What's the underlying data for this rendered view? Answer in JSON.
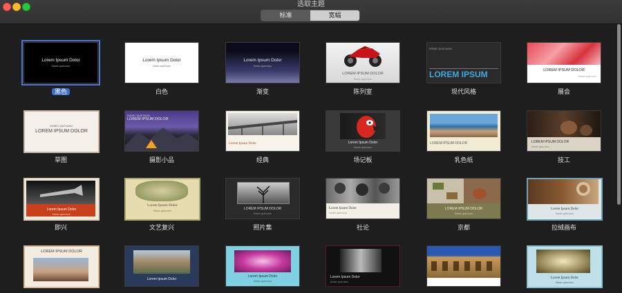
{
  "window": {
    "title": "选取主题"
  },
  "tabs": [
    {
      "label": "标准",
      "active": false
    },
    {
      "label": "宽幅",
      "active": true
    }
  ],
  "sample_text": {
    "heading": "Lorem Ipsum Dolor",
    "heading_caps": "LOREM IPSUM DOLOR",
    "heading_big": "LOREM IPSUM",
    "kicker": "DONEC QUIS NUNC",
    "sub": "Donec quis nunc"
  },
  "themes": [
    {
      "name": "黑色",
      "selected": true
    },
    {
      "name": "白色"
    },
    {
      "name": "渐变"
    },
    {
      "name": "陈列室"
    },
    {
      "name": "现代风格"
    },
    {
      "name": "展会"
    },
    {
      "name": "草图"
    },
    {
      "name": "摄影小品"
    },
    {
      "name": "经典"
    },
    {
      "name": "场记板"
    },
    {
      "name": "乳色纸"
    },
    {
      "name": "技工"
    },
    {
      "name": "即兴"
    },
    {
      "name": "文艺复兴"
    },
    {
      "name": "照片集"
    },
    {
      "name": "社论"
    },
    {
      "name": "京都"
    },
    {
      "name": "拉绒画布"
    }
  ],
  "colors": {
    "selection": "#3d6ed0",
    "background": "#1e1e1e"
  }
}
